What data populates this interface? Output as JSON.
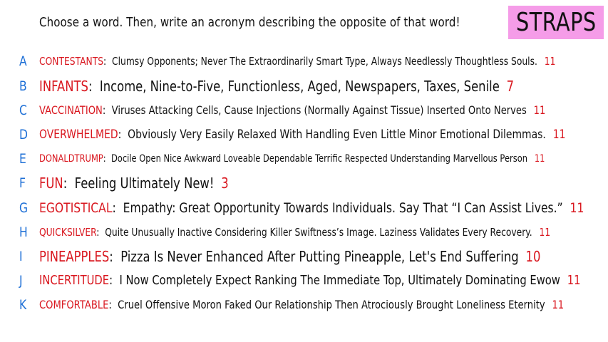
{
  "prompt": "Choose a word. Then, write an acronym describing the opposite of that word!",
  "badge": "STRAPS",
  "rows": [
    {
      "letter": "A",
      "word": "CONTESTANTS",
      "acronym": "Clumsy Opponents; Never The Extraordinarily Smart Type, Always Needlessly Thoughtless Souls.",
      "count": "11"
    },
    {
      "letter": "B",
      "word": "INFANTS",
      "acronym": "Income, Nine-to-Five, Functionless, Aged, Newspapers, Taxes, Senile",
      "count": "7"
    },
    {
      "letter": "C",
      "word": "VACCINATION",
      "acronym": "Viruses Attacking Cells, Cause Injections (Normally Against Tissue) Inserted Onto Nerves",
      "count": "11"
    },
    {
      "letter": "D",
      "word": "OVERWHELMED",
      "acronym": "Obviously Very Easily Relaxed With Handling Even Little Minor Emotional Dilemmas.",
      "count": "11"
    },
    {
      "letter": "E",
      "word": "DONALDTRUMP",
      "acronym": "Docile Open Nice Awkward Loveable Dependable Terrific Respected Understanding Marvellous Person",
      "count": "11"
    },
    {
      "letter": "F",
      "word": "FUN",
      "acronym": "Feeling Ultimately New!",
      "count": "3"
    },
    {
      "letter": "G",
      "word": "EGOTISTICAL",
      "acronym": "Empathy: Great Opportunity Towards Individuals. Say That “I Can Assist Lives.”",
      "count": "11"
    },
    {
      "letter": "H",
      "word": "QUICKSILVER",
      "acronym": "Quite Unusually Inactive Considering Killer Swiftness’s Image. Laziness Validates Every Recovery.",
      "count": "11"
    },
    {
      "letter": "I",
      "word": "PINEAPPLES",
      "acronym": "Pizza Is Never Enhanced After Putting Pineapple, Let's End Suffering",
      "count": "10"
    },
    {
      "letter": "J",
      "word": "INCERTITUDE",
      "acronym": "I Now Completely Expect Ranking The Immediate Top, Ultimately Dominating Ewow",
      "count": "11"
    },
    {
      "letter": "K",
      "word": "COMFORTABLE",
      "acronym": "Cruel Offensive Moron Faked Our Relationship Then Atrociously Brought Loneliness Eternity",
      "count": "11"
    }
  ]
}
